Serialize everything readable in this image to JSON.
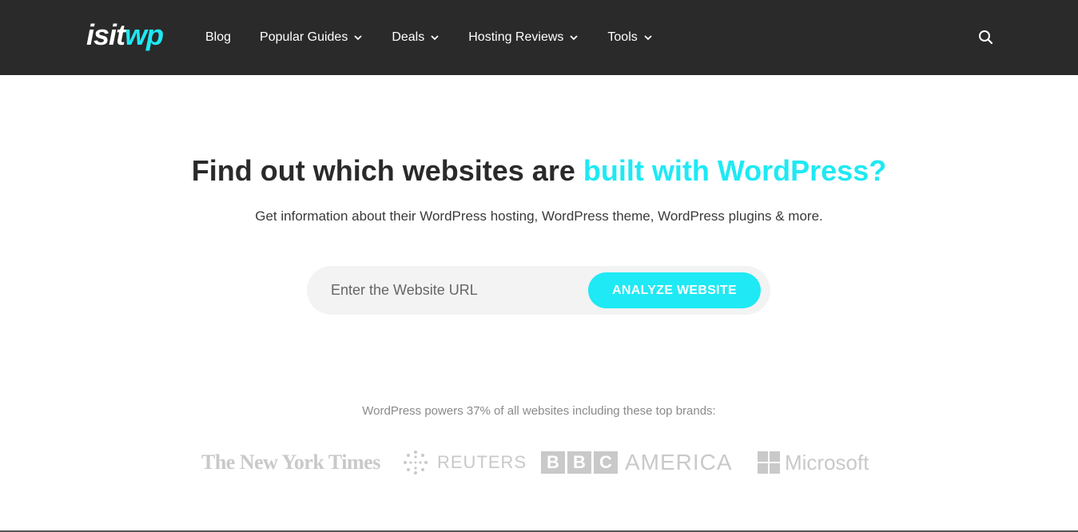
{
  "header": {
    "logo": {
      "part1": "isit",
      "part2": "wp"
    },
    "nav": [
      {
        "label": "Blog",
        "has_dropdown": false
      },
      {
        "label": "Popular Guides",
        "has_dropdown": true
      },
      {
        "label": "Deals",
        "has_dropdown": true
      },
      {
        "label": "Hosting Reviews",
        "has_dropdown": true
      },
      {
        "label": "Tools",
        "has_dropdown": true
      }
    ],
    "search_icon": "search-icon"
  },
  "hero": {
    "headline_plain": "Find out which websites are ",
    "headline_accent": "built with WordPress?",
    "subtitle": "Get information about their WordPress hosting, WordPress theme, WordPress plugins & more.",
    "input_placeholder": "Enter the Website URL",
    "button_label": "ANALYZE WEBSITE"
  },
  "brands": {
    "caption": "WordPress powers 37% of all websites including these top brands:",
    "logos": {
      "nyt": "The New York Times",
      "reuters": "REUTERS",
      "bbc_letters": [
        "B",
        "B",
        "C"
      ],
      "bbc_america": "AMERICA",
      "microsoft": "Microsoft"
    }
  },
  "colors": {
    "accent": "#1ee9f4",
    "topbar": "#2a2a2a",
    "logo_gray": "#c9c9c9"
  }
}
